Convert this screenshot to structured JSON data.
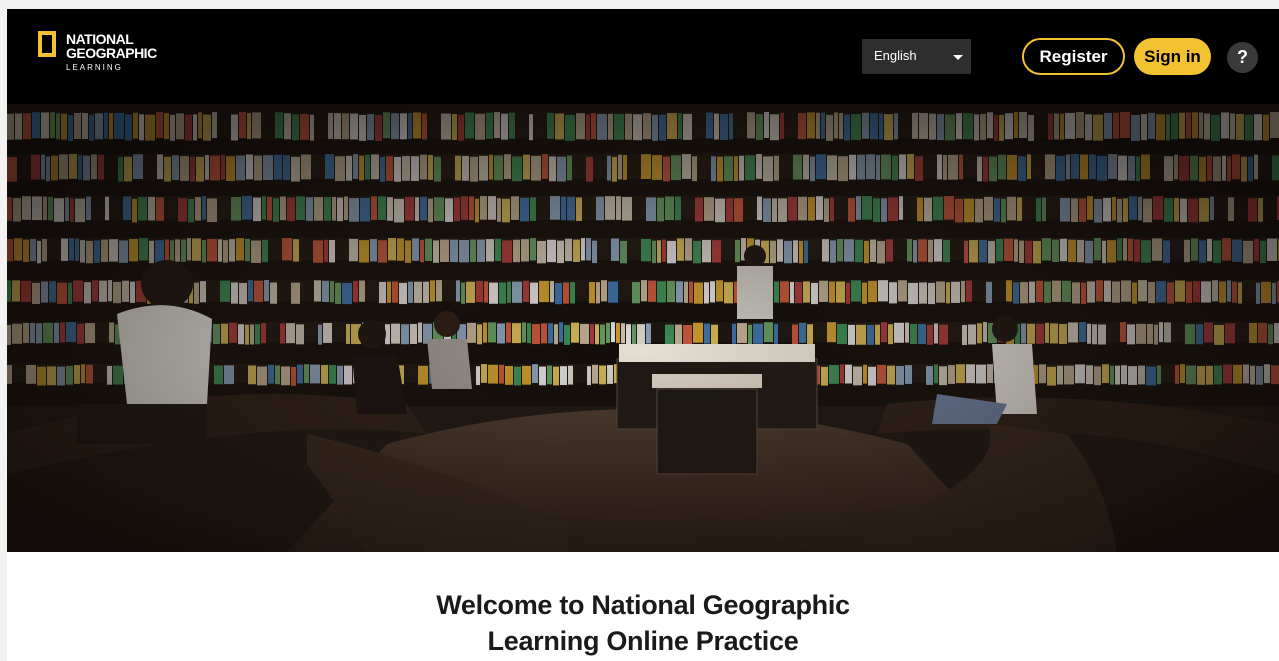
{
  "header": {
    "logo": {
      "line1": "NATIONAL",
      "line2": "GEOGRAPHIC",
      "line3": "LEARNING",
      "icon": "yellow-border-rectangle",
      "accent_color": "#f2c230"
    },
    "language": {
      "selected": "English"
    },
    "register_label": "Register",
    "signin_label": "Sign in",
    "help_label": "?"
  },
  "hero": {
    "image_description": "Circular library bookstore with shelves of books and readers seated on curved benches"
  },
  "main": {
    "welcome_line1": "Welcome to National Geographic",
    "welcome_line2": "Learning Online Practice"
  }
}
